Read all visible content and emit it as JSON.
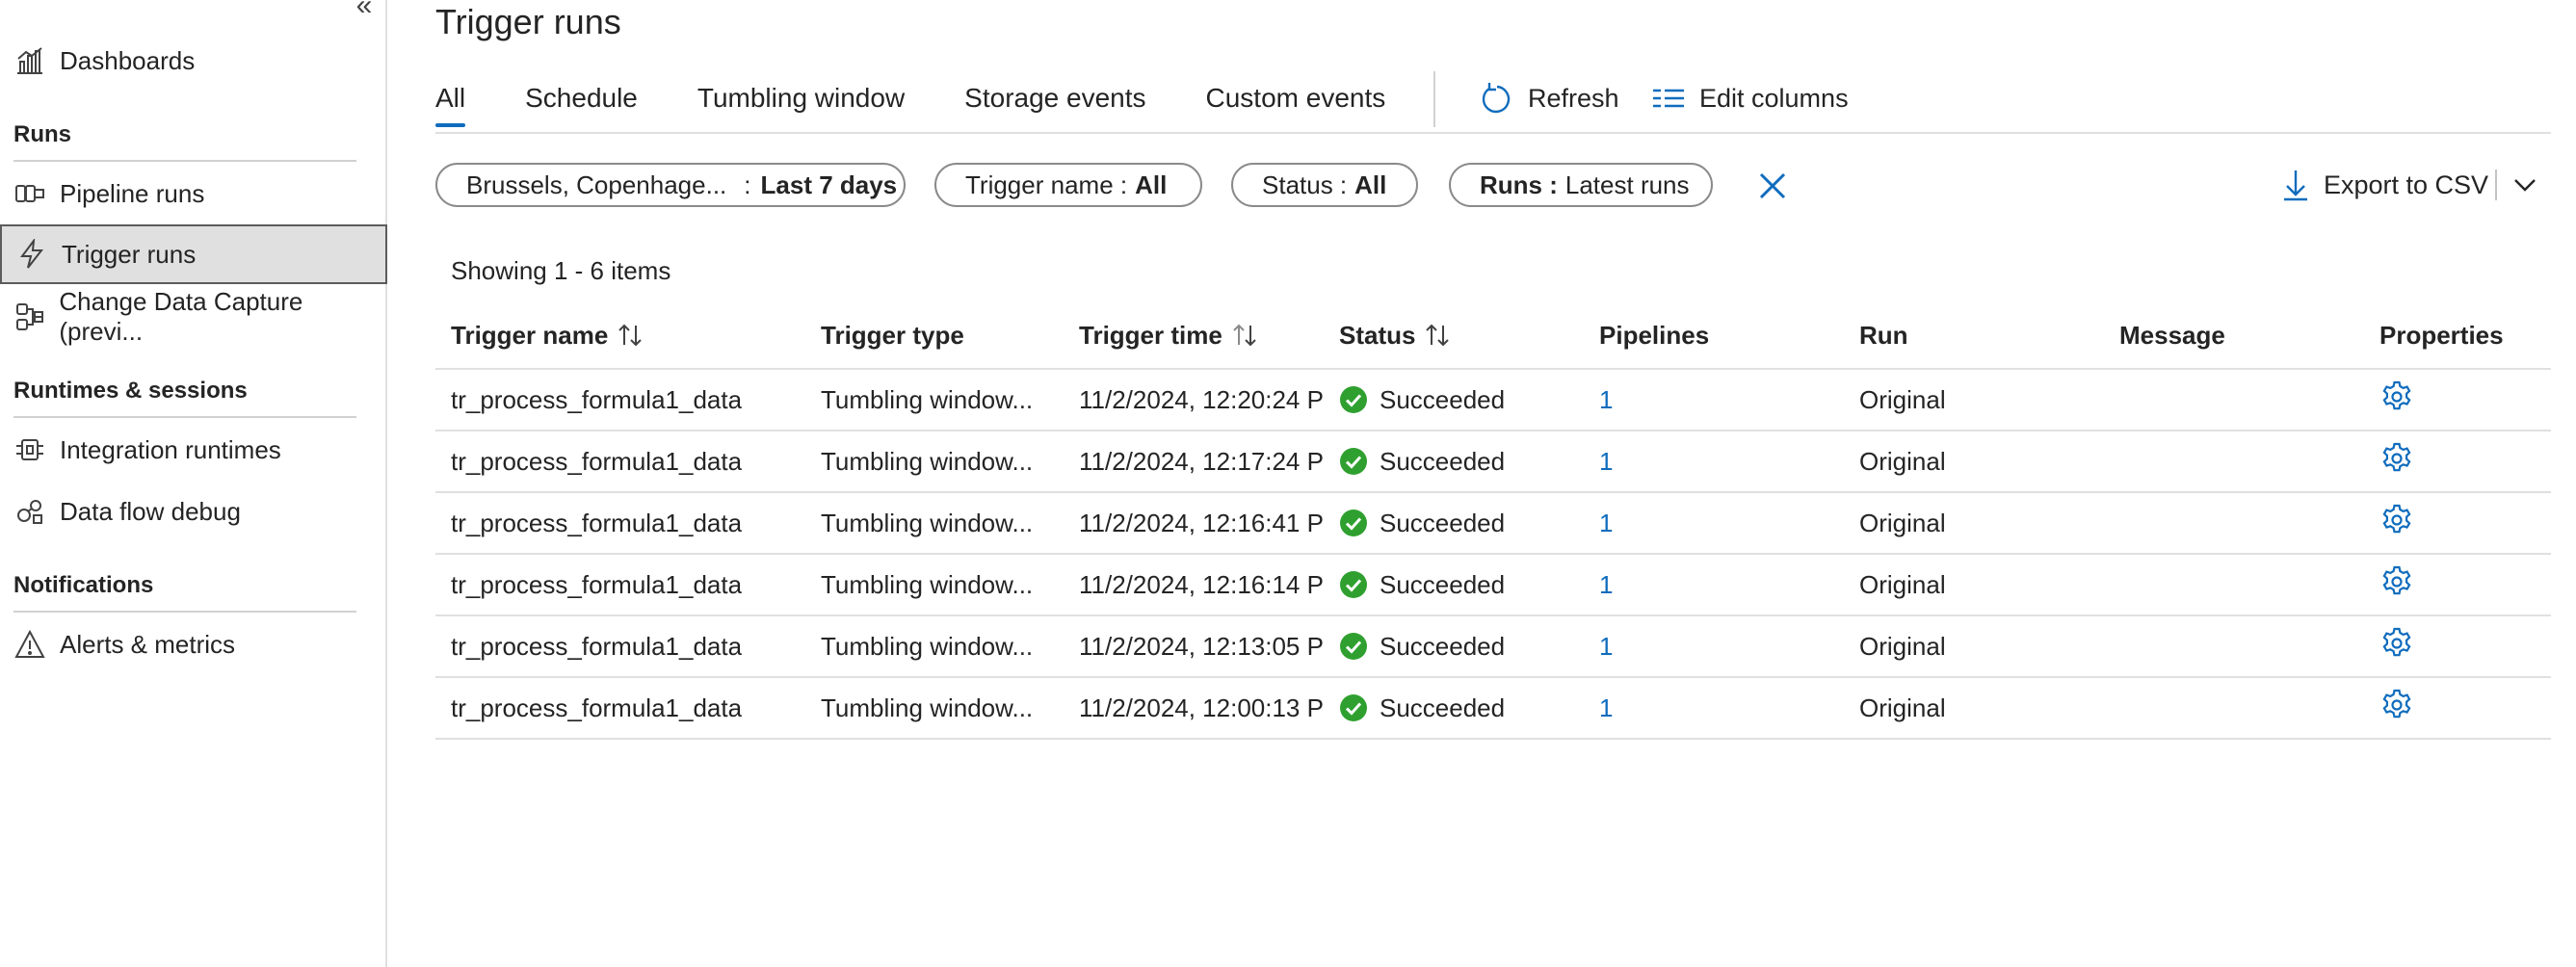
{
  "sidebar": {
    "items": {
      "dashboards": "Dashboards",
      "pipeline_runs": "Pipeline runs",
      "trigger_runs": "Trigger runs",
      "change_data_capture": "Change Data Capture (previ...",
      "integration_runtimes": "Integration runtimes",
      "data_flow_debug": "Data flow debug",
      "alerts_metrics": "Alerts & metrics"
    },
    "sections": {
      "runs": "Runs",
      "runtimes": "Runtimes & sessions",
      "notifications": "Notifications"
    },
    "active_item": "Trigger runs"
  },
  "page": {
    "title": "Trigger runs"
  },
  "tabs": [
    {
      "label": "All",
      "active": true
    },
    {
      "label": "Schedule"
    },
    {
      "label": "Tumbling window"
    },
    {
      "label": "Storage events"
    },
    {
      "label": "Custom events"
    }
  ],
  "toolbar": {
    "refresh": "Refresh",
    "edit_columns": "Edit columns",
    "export": "Export to CSV"
  },
  "filters": {
    "timezone": {
      "label": "Brussels, Copenhage...",
      "sep": ":",
      "value": "Last 7 days"
    },
    "trigger_name": {
      "label": "Trigger name :",
      "value": "All"
    },
    "status": {
      "label": "Status :",
      "value": "All"
    },
    "runs": {
      "label": "Runs :",
      "value": "Latest runs"
    }
  },
  "table": {
    "showing": "Showing 1 - 6 items",
    "headers": {
      "trigger_name": "Trigger name",
      "trigger_type": "Trigger type",
      "trigger_time": "Trigger time",
      "status": "Status",
      "pipelines": "Pipelines",
      "run": "Run",
      "message": "Message",
      "properties": "Properties"
    },
    "rows": [
      {
        "name": "tr_process_formula1_data",
        "type": "Tumbling window...",
        "time": "11/2/2024, 12:20:24 P",
        "status": "Succeeded",
        "pipelines": "1",
        "run": "Original",
        "message": ""
      },
      {
        "name": "tr_process_formula1_data",
        "type": "Tumbling window...",
        "time": "11/2/2024, 12:17:24 P",
        "status": "Succeeded",
        "pipelines": "1",
        "run": "Original",
        "message": ""
      },
      {
        "name": "tr_process_formula1_data",
        "type": "Tumbling window...",
        "time": "11/2/2024, 12:16:41 P",
        "status": "Succeeded",
        "pipelines": "1",
        "run": "Original",
        "message": ""
      },
      {
        "name": "tr_process_formula1_data",
        "type": "Tumbling window...",
        "time": "11/2/2024, 12:16:14 P",
        "status": "Succeeded",
        "pipelines": "1",
        "run": "Original",
        "message": ""
      },
      {
        "name": "tr_process_formula1_data",
        "type": "Tumbling window...",
        "time": "11/2/2024, 12:13:05 P",
        "status": "Succeeded",
        "pipelines": "1",
        "run": "Original",
        "message": ""
      },
      {
        "name": "tr_process_formula1_data",
        "type": "Tumbling window...",
        "time": "11/2/2024, 12:00:13 P",
        "status": "Succeeded",
        "pipelines": "1",
        "run": "Original",
        "message": ""
      }
    ]
  },
  "icons": {
    "collapse": "double-chevron-left-icon",
    "dashboards": "chart-icon",
    "pipeline_runs": "pipeline-icon",
    "trigger_runs": "lightning-icon",
    "cdc": "cdc-icon",
    "integration_runtimes": "runtime-icon",
    "data_flow_debug": "debug-icon",
    "alerts": "warning-icon",
    "refresh": "refresh-icon",
    "edit_columns": "columns-icon",
    "clear": "close-icon",
    "export": "download-icon",
    "sort": "sort-icon",
    "success": "check-circle-icon",
    "properties": "gear-icon"
  },
  "colors": {
    "accent": "#0f6cbd",
    "success": "#2fa02f",
    "active_bg": "#e0e0e0"
  }
}
